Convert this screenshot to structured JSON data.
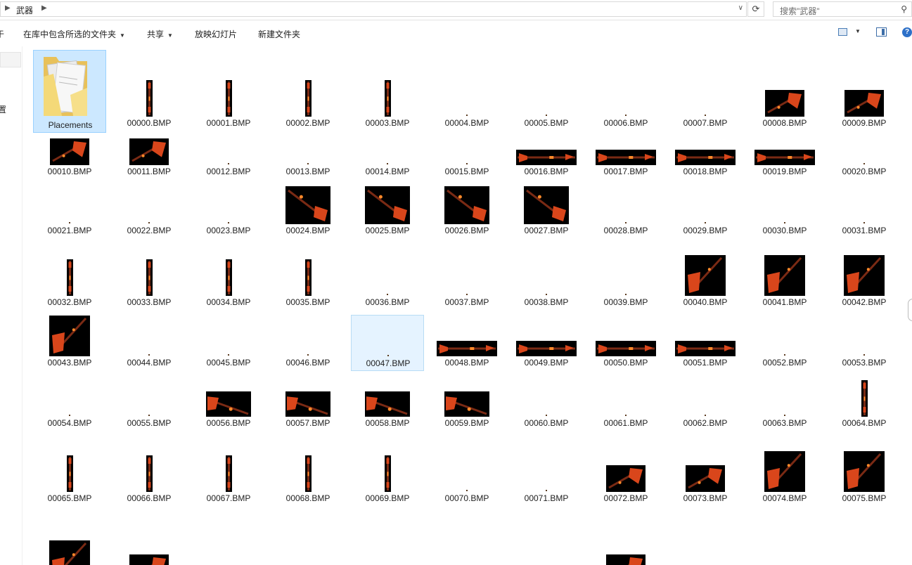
{
  "address": {
    "breadcrumb": "武器",
    "search_placeholder": "搜索\"武器\""
  },
  "toolbar": {
    "items": [
      "在库中包含所选的文件夹",
      "共享",
      "放映幻灯片",
      "新建文件夹"
    ],
    "left_edge_char": "于"
  },
  "nav": {
    "partial_label": "置"
  },
  "colors": {
    "selection": "#cce8ff",
    "hover": "#e5f3ff",
    "thumb_bg": "#000000",
    "blade": "#d9461b"
  },
  "folder": {
    "label": "Placements"
  },
  "files": [
    {
      "name": "00000.BMP",
      "shape": "v"
    },
    {
      "name": "00001.BMP",
      "shape": "v"
    },
    {
      "name": "00002.BMP",
      "shape": "v"
    },
    {
      "name": "00003.BMP",
      "shape": "v"
    },
    {
      "name": "00004.BMP",
      "shape": "dot"
    },
    {
      "name": "00005.BMP",
      "shape": "dot"
    },
    {
      "name": "00006.BMP",
      "shape": "dot"
    },
    {
      "name": "00007.BMP",
      "shape": "dot"
    },
    {
      "name": "00008.BMP",
      "shape": "d"
    },
    {
      "name": "00009.BMP",
      "shape": "d"
    },
    {
      "name": "00010.BMP",
      "shape": "d"
    },
    {
      "name": "00011.BMP",
      "shape": "d"
    },
    {
      "name": "00012.BMP",
      "shape": "dot"
    },
    {
      "name": "00013.BMP",
      "shape": "dot"
    },
    {
      "name": "00014.BMP",
      "shape": "dot"
    },
    {
      "name": "00015.BMP",
      "shape": "dot"
    },
    {
      "name": "00016.BMP",
      "shape": "h"
    },
    {
      "name": "00017.BMP",
      "shape": "h"
    },
    {
      "name": "00018.BMP",
      "shape": "h"
    },
    {
      "name": "00019.BMP",
      "shape": "h"
    },
    {
      "name": "00020.BMP",
      "shape": "dot"
    },
    {
      "name": "00021.BMP",
      "shape": "dot"
    },
    {
      "name": "00022.BMP",
      "shape": "dot"
    },
    {
      "name": "00023.BMP",
      "shape": "dot"
    },
    {
      "name": "00024.BMP",
      "shape": "r"
    },
    {
      "name": "00025.BMP",
      "shape": "r"
    },
    {
      "name": "00026.BMP",
      "shape": "r"
    },
    {
      "name": "00027.BMP",
      "shape": "r"
    },
    {
      "name": "00028.BMP",
      "shape": "dot"
    },
    {
      "name": "00029.BMP",
      "shape": "dot"
    },
    {
      "name": "00030.BMP",
      "shape": "dot"
    },
    {
      "name": "00031.BMP",
      "shape": "dot"
    },
    {
      "name": "00032.BMP",
      "shape": "v"
    },
    {
      "name": "00033.BMP",
      "shape": "v"
    },
    {
      "name": "00034.BMP",
      "shape": "v"
    },
    {
      "name": "00035.BMP",
      "shape": "v"
    },
    {
      "name": "00036.BMP",
      "shape": "dot"
    },
    {
      "name": "00037.BMP",
      "shape": "dot"
    },
    {
      "name": "00038.BMP",
      "shape": "dot"
    },
    {
      "name": "00039.BMP",
      "shape": "dot"
    },
    {
      "name": "00040.BMP",
      "shape": "u"
    },
    {
      "name": "00041.BMP",
      "shape": "u"
    },
    {
      "name": "00042.BMP",
      "shape": "u"
    },
    {
      "name": "00043.BMP",
      "shape": "u"
    },
    {
      "name": "00044.BMP",
      "shape": "dot"
    },
    {
      "name": "00045.BMP",
      "shape": "dot"
    },
    {
      "name": "00046.BMP",
      "shape": "dot"
    },
    {
      "name": "00047.BMP",
      "shape": "dot",
      "hover": true
    },
    {
      "name": "00048.BMP",
      "shape": "hw"
    },
    {
      "name": "00049.BMP",
      "shape": "hw"
    },
    {
      "name": "00050.BMP",
      "shape": "hw"
    },
    {
      "name": "00051.BMP",
      "shape": "hw"
    },
    {
      "name": "00052.BMP",
      "shape": "dot"
    },
    {
      "name": "00053.BMP",
      "shape": "dot"
    },
    {
      "name": "00054.BMP",
      "shape": "dot"
    },
    {
      "name": "00055.BMP",
      "shape": "dot"
    },
    {
      "name": "00056.BMP",
      "shape": "s"
    },
    {
      "name": "00057.BMP",
      "shape": "s"
    },
    {
      "name": "00058.BMP",
      "shape": "s"
    },
    {
      "name": "00059.BMP",
      "shape": "s"
    },
    {
      "name": "00060.BMP",
      "shape": "dot"
    },
    {
      "name": "00061.BMP",
      "shape": "dot"
    },
    {
      "name": "00062.BMP",
      "shape": "dot"
    },
    {
      "name": "00063.BMP",
      "shape": "dot"
    },
    {
      "name": "00064.BMP",
      "shape": "v"
    },
    {
      "name": "00065.BMP",
      "shape": "v"
    },
    {
      "name": "00066.BMP",
      "shape": "v"
    },
    {
      "name": "00067.BMP",
      "shape": "v"
    },
    {
      "name": "00068.BMP",
      "shape": "v"
    },
    {
      "name": "00069.BMP",
      "shape": "v"
    },
    {
      "name": "00070.BMP",
      "shape": "dot"
    },
    {
      "name": "00071.BMP",
      "shape": "dot"
    },
    {
      "name": "00072.BMP",
      "shape": "d"
    },
    {
      "name": "00073.BMP",
      "shape": "d"
    },
    {
      "name": "00074.BMP",
      "shape": "u"
    },
    {
      "name": "00075.BMP",
      "shape": "u"
    },
    {
      "name": "",
      "shape": "u"
    },
    {
      "name": "",
      "shape": "d"
    },
    {
      "name": "",
      "shape": "none"
    },
    {
      "name": "",
      "shape": "none"
    },
    {
      "name": "",
      "shape": "h"
    },
    {
      "name": "",
      "shape": "h"
    },
    {
      "name": "",
      "shape": "h"
    },
    {
      "name": "",
      "shape": "d"
    },
    {
      "name": "",
      "shape": "h"
    },
    {
      "name": "",
      "shape": "h"
    }
  ]
}
